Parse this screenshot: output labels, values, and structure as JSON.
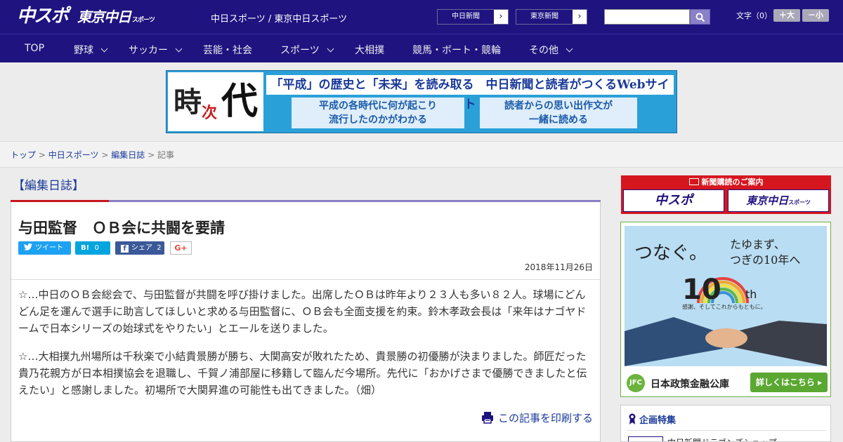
{
  "header": {
    "logo_main": "中スポ",
    "logo_tokyo": "東京中日",
    "logo_tokyo_small": "スポーツ",
    "site_title": "中日スポーツ / 東京中日スポーツ",
    "links": [
      {
        "label": "中日新聞",
        "arrow": "›"
      },
      {
        "label": "東京新聞",
        "arrow": "›"
      }
    ],
    "font_size_label": "文字（0）",
    "font_plus": "＋大",
    "font_minus": "－小"
  },
  "nav": {
    "items": [
      {
        "label": "TOP",
        "dropdown": false
      },
      {
        "label": "野球",
        "dropdown": true
      },
      {
        "label": "サッカー",
        "dropdown": true
      },
      {
        "label": "芸能・社会",
        "dropdown": false
      },
      {
        "label": "スポーツ",
        "dropdown": true
      },
      {
        "label": "大相撲",
        "dropdown": false
      },
      {
        "label": "競馬・ボート・競輪",
        "dropdown": false
      },
      {
        "label": "その他",
        "dropdown": true
      }
    ]
  },
  "banner": {
    "ji": "時",
    "tsugi": "次",
    "dai": "代",
    "headline": "「平成」の歴史と「未来」を読み取る　中日新聞と読者がつくるWebサイト",
    "box1": "平成の各時代に何が起こり\n流行したのかがわかる",
    "box2": "読者からの思い出作文が\n一緒に読める"
  },
  "breadcrumb": {
    "items": [
      "トップ",
      "中日スポーツ",
      "編集日誌"
    ],
    "current": "記事",
    "sep": ">"
  },
  "section_title": "【編集日誌】",
  "article": {
    "title": "与田監督　ＯＢ会に共闘を要請",
    "share": {
      "tweet": "ツイート",
      "hatena_icon": "B!",
      "hatena_count": "0",
      "fb_label": "シェア",
      "fb_count": "2",
      "gplus": "G+"
    },
    "date": "2018年11月26日",
    "paragraphs": [
      "☆…中日のＯＢ会総会で、与田監督が共闘を呼び掛けました。出席したＯＢは昨年より２３人も多い８２人。球場にどんどん足を運んで選手に助言してほしいと求める与田監督に、ＯＢ会も全面支援を約束。鈴木孝政会長は「来年はナゴヤドームで日本シリーズの始球式をやりたい」とエールを送りました。",
      "☆…大相撲九州場所は千秋楽で小結貴景勝が勝ち、大関高安が敗れたため、貴景勝の初優勝が決まりました。師匠だった貴乃花親方が日本相撲協会を退職し、千賀ノ浦部屋に移籍して臨んだ今場所。先代に「おかげさまで優勝できましたと伝えたい」と感謝しました。初場所で大関昇進の可能性も出てきました。（畑）"
    ],
    "print_label": "この記事を印刷する"
  },
  "sidebar": {
    "subscribe": {
      "caption": "新聞購読のご案内",
      "logo1": "中スポ",
      "logo2": "東京中日",
      "logo2_small": "スポーツ"
    },
    "jfc_ad": {
      "tagline1": "つなぐ。",
      "tagline2": "たゆまず、\nつぎの10年へ",
      "ten": "10",
      "th": "th",
      "subtag": "感謝、そしてこれからもともに。",
      "logo": "JFC",
      "name": "日本政策金融公庫",
      "button": "詳しくはこちら ▸"
    },
    "kikaku": {
      "title": "企画特集",
      "item": "中日新聞ドラゴンズショップ"
    }
  },
  "colors": {
    "brand_navy": "#1f1380",
    "link_blue": "#1a3a9a",
    "accent_red": "#c8161d",
    "twitter": "#1da1f2",
    "hatena": "#00a4de",
    "facebook": "#3b5998"
  }
}
